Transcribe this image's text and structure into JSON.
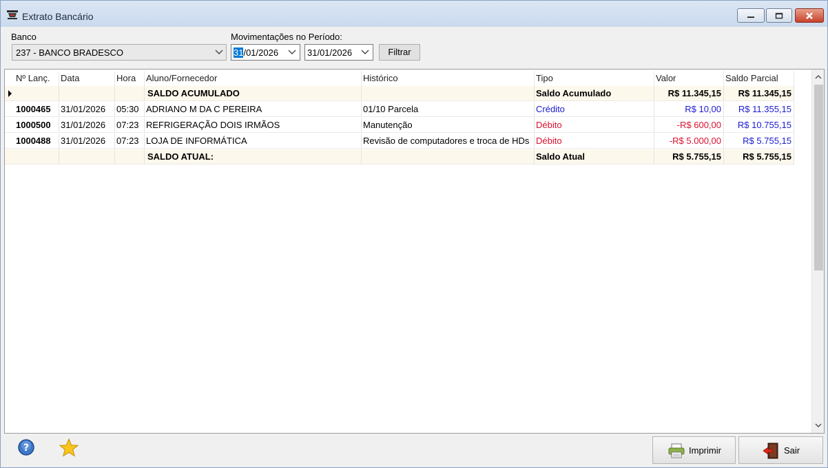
{
  "window": {
    "title": "Extrato Bancário"
  },
  "filters": {
    "bank_label": "Banco",
    "bank_value": "237 - BANCO BRADESCO",
    "period_label": "Movimentações no Período:",
    "date_from_sel": "31",
    "date_from_rest": "/01/2026",
    "date_to": "31/01/2026",
    "filter_button": "Filtrar"
  },
  "table": {
    "columns": [
      "Nº Lanç.",
      "Data",
      "Hora",
      "Aluno/Fornecedor",
      "Histórico",
      "Tipo",
      "Valor",
      "Saldo Parcial"
    ],
    "rows": [
      {
        "num": "",
        "date": "",
        "time": "",
        "name": "SALDO ACUMULADO",
        "history": "",
        "type": "Saldo Acumulado",
        "value": "R$ 11.345,15",
        "balance": "R$ 11.345,15"
      },
      {
        "num": "1000465",
        "date": "31/01/2026",
        "time": "05:30",
        "name": "ADRIANO M DA C PEREIRA",
        "history": "01/10 Parcela",
        "type": "Crédito",
        "value": "R$ 10,00",
        "balance": "R$ 11.355,15"
      },
      {
        "num": "1000500",
        "date": "31/01/2026",
        "time": "07:23",
        "name": "REFRIGERAÇÃO DOIS IRMÃOS",
        "history": "Manutenção",
        "type": "Débito",
        "value": "-R$ 600,00",
        "balance": "R$ 10.755,15"
      },
      {
        "num": "1000488",
        "date": "31/01/2026",
        "time": "07:23",
        "name": "LOJA DE INFORMÁTICA",
        "history": "Revisão de computadores e troca de HDs",
        "type": "Débito",
        "value": "-R$ 5.000,00",
        "balance": "R$ 5.755,15"
      },
      {
        "num": "",
        "date": "",
        "time": "",
        "name": "SALDO ATUAL:",
        "history": "",
        "type": "Saldo Atual",
        "value": "R$ 5.755,15",
        "balance": "R$ 5.755,15"
      }
    ]
  },
  "footer": {
    "help_icon": "help-icon",
    "favorite_icon": "star-icon",
    "print_label": "Imprimir",
    "exit_label": "Sair"
  },
  "colors": {
    "credit": "#1a1ad2",
    "debit": "#d8102e",
    "summary_row": "#fdf8ec"
  }
}
